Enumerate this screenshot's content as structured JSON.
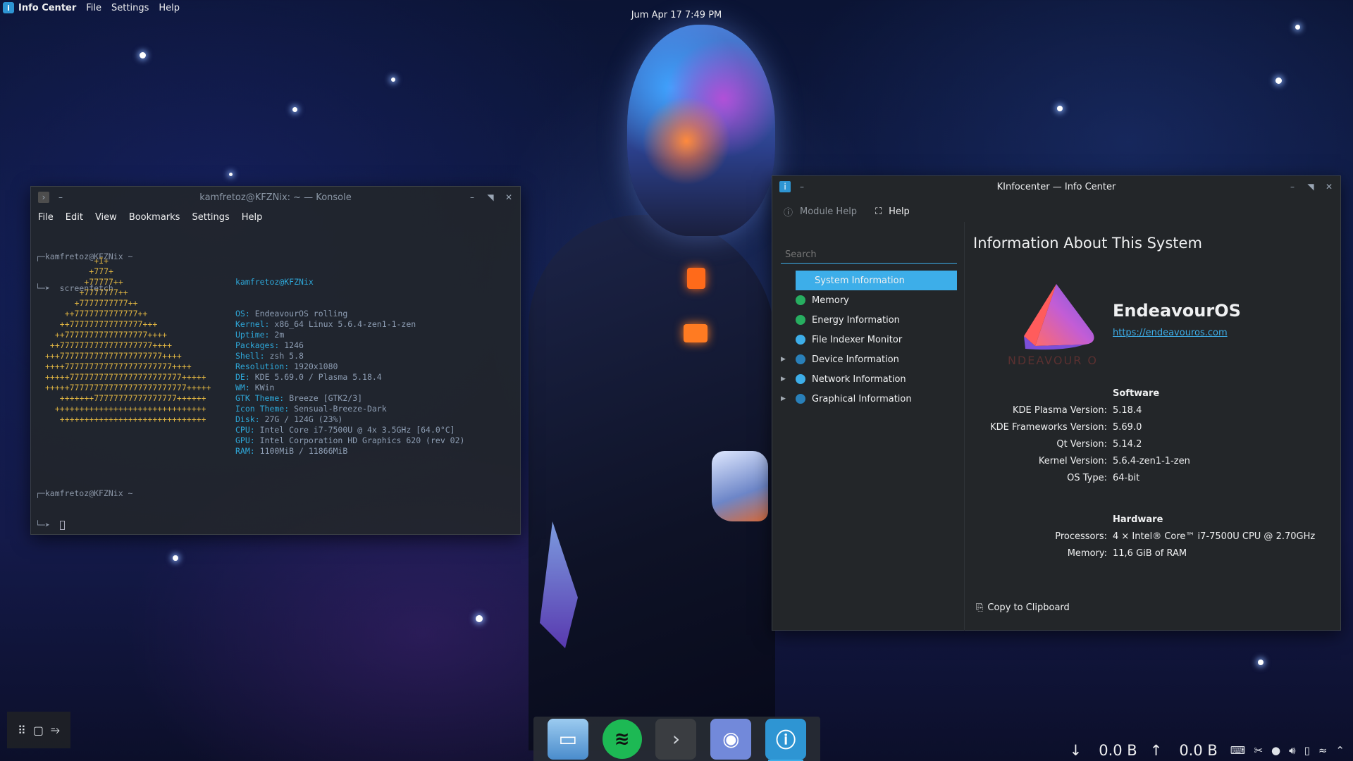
{
  "top_panel": {
    "app_name": "Info Center",
    "menu": [
      "File",
      "Settings",
      "Help"
    ],
    "clock": "Jum Apr 17 7:49 PM"
  },
  "konsole": {
    "title": "kamfretoz@KFZNix: ~ — Konsole",
    "menu": [
      "File",
      "Edit",
      "View",
      "Bookmarks",
      "Settings",
      "Help"
    ],
    "prompt1": "┌─kamfretoz@KFZNix ~",
    "cmd1": "└─➤  screenfetch",
    "logo_lines": [
      "          +I+",
      "         +777+",
      "        +77777++",
      "       +7777777++",
      "      +7777777777++",
      "    ++7777777777777++",
      "   ++777777777777777+++",
      "  ++77777777777777777++++",
      " ++7777777777777777777++++",
      "+++777777777777777777777++++",
      "++++7777777777777777777777++++",
      "+++++77777777777777777777777+++++",
      "+++++777777777777777777777777+++++",
      "   +++++++77777777777777777++++++",
      "  +++++++++++++++++++++++++++++++",
      "   ++++++++++++++++++++++++++++++"
    ],
    "info_user": "kamfretoz@KFZNix",
    "info": [
      {
        "k": "OS:",
        "v": "EndeavourOS rolling"
      },
      {
        "k": "Kernel:",
        "v": "x86_64 Linux 5.6.4-zen1-1-zen"
      },
      {
        "k": "Uptime:",
        "v": "2m"
      },
      {
        "k": "Packages:",
        "v": "1246"
      },
      {
        "k": "Shell:",
        "v": "zsh 5.8"
      },
      {
        "k": "Resolution:",
        "v": "1920x1080"
      },
      {
        "k": "DE:",
        "v": "KDE 5.69.0 / Plasma 5.18.4"
      },
      {
        "k": "WM:",
        "v": "KWin"
      },
      {
        "k": "GTK Theme:",
        "v": "Breeze [GTK2/3]"
      },
      {
        "k": "Icon Theme:",
        "v": "Sensual-Breeze-Dark"
      },
      {
        "k": "Disk:",
        "v": "27G / 124G (23%)"
      },
      {
        "k": "CPU:",
        "v": "Intel Core i7-7500U @ 4x 3.5GHz [64.0°C]"
      },
      {
        "k": "GPU:",
        "v": "Intel Corporation HD Graphics 620 (rev 02)"
      },
      {
        "k": "RAM:",
        "v": "1100MiB / 11866MiB"
      }
    ],
    "prompt2": "┌─kamfretoz@KFZNix ~",
    "cmd2": "└─➤  "
  },
  "infocenter": {
    "title": "KInfocenter — Info Center",
    "toolbar": {
      "module_help": "Module Help",
      "help": "Help"
    },
    "search_placeholder": "Search",
    "sidebar": [
      {
        "label": "System Information",
        "icon": "info-icon",
        "color": "#3daee9",
        "expandable": false,
        "selected": true
      },
      {
        "label": "Memory",
        "icon": "memory-icon",
        "color": "#27ae60",
        "expandable": false
      },
      {
        "label": "Energy Information",
        "icon": "energy-icon",
        "color": "#27ae60",
        "expandable": false
      },
      {
        "label": "File Indexer Monitor",
        "icon": "indexer-icon",
        "color": "#3daee9",
        "expandable": false
      },
      {
        "label": "Device Information",
        "icon": "device-icon",
        "color": "#2980b9",
        "expandable": true
      },
      {
        "label": "Network Information",
        "icon": "network-icon",
        "color": "#3daee9",
        "expandable": true
      },
      {
        "label": "Graphical Information",
        "icon": "graphics-icon",
        "color": "#2980b9",
        "expandable": true
      }
    ],
    "heading": "Information About This System",
    "os_name": "EndeavourOS",
    "os_url": "https://endeavouros.com",
    "logo_wordmark": "ENDEAVOUR OS",
    "software_title": "Software",
    "software": [
      {
        "k": "KDE Plasma Version:",
        "v": "5.18.4"
      },
      {
        "k": "KDE Frameworks Version:",
        "v": "5.69.0"
      },
      {
        "k": "Qt Version:",
        "v": "5.14.2"
      },
      {
        "k": "Kernel Version:",
        "v": "5.6.4-zen1-1-zen"
      },
      {
        "k": "OS Type:",
        "v": "64-bit"
      }
    ],
    "hardware_title": "Hardware",
    "hardware": [
      {
        "k": "Processors:",
        "v": "4 × Intel® Core™ i7-7500U CPU @ 2.70GHz"
      },
      {
        "k": "Memory:",
        "v": "11,6 GiB of RAM"
      }
    ],
    "copy_button": "Copy to Clipboard"
  },
  "dock": {
    "items": [
      {
        "name": "files-app-icon",
        "color": "#7fb7e6"
      },
      {
        "name": "spotify-app-icon",
        "color": "#1db954"
      },
      {
        "name": "konsole-app-icon",
        "color": "#4d4d4d"
      },
      {
        "name": "discord-app-icon",
        "color": "#7289da"
      },
      {
        "name": "infocenter-app-icon",
        "color": "#2e95d3",
        "active": true
      }
    ]
  },
  "tray": {
    "down_speed": "0.0 B",
    "up_speed": "0.0 B"
  }
}
